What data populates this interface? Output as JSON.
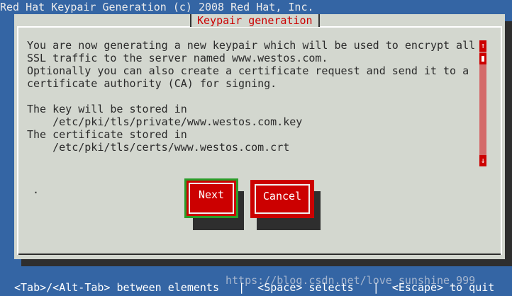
{
  "top_title": "Red Hat Keypair Generation (c) 2008 Red Hat, Inc.",
  "dialog": {
    "title": "Keypair generation",
    "lines": [
      "You are now generating a new keypair which will be used to encrypt all",
      "SSL traffic to the server named www.westos.com.",
      "Optionally you can also create a certificate request and send it to a",
      "certificate authority (CA) for signing.",
      "",
      "The key will be stored in",
      "    /etc/pki/tls/private/www.westos.com.key",
      "The certificate stored in",
      "    /etc/pki/tls/certs/www.westos.com.crt"
    ],
    "dot": ".",
    "buttons": {
      "next": "Next",
      "cancel": "Cancel"
    }
  },
  "status_bar": "<Tab>/<Alt-Tab> between elements   |  <Space> selects   |  <Escape> to quit",
  "watermark": "https://blog.csdn.net/love_sunshine_999",
  "icons": {
    "scroll_up": "up-arrow-icon",
    "scroll_down": "down-arrow-icon"
  },
  "colors": {
    "background": "#3465a4",
    "dialog": "#d3d7cf",
    "accent": "#cc0000",
    "focus": "#2a9d2a"
  }
}
